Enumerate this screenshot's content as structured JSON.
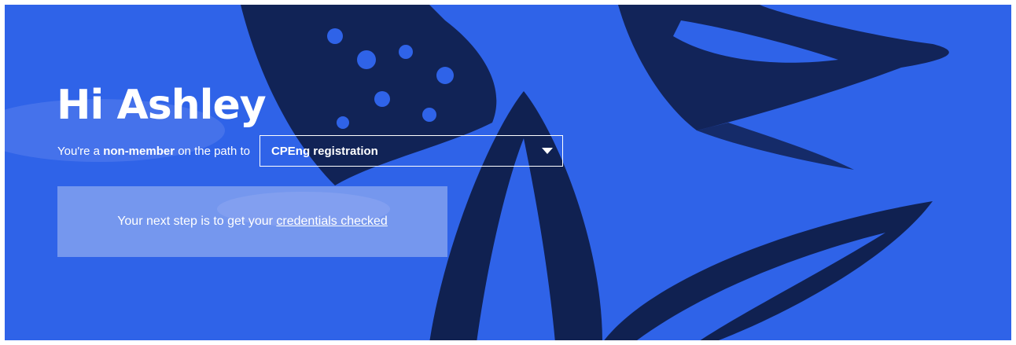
{
  "user": {
    "greeting": "Hi Ashley"
  },
  "status": {
    "prefix": "You're a",
    "membership": "non-member",
    "suffix": "on the path to"
  },
  "path_select": {
    "selected": "CPEng registration"
  },
  "next_step": {
    "text": "Your next step is to get your",
    "link_text": "credentials checked"
  },
  "colors": {
    "hero_background": "#2f63e8",
    "text": "#ffffff"
  }
}
